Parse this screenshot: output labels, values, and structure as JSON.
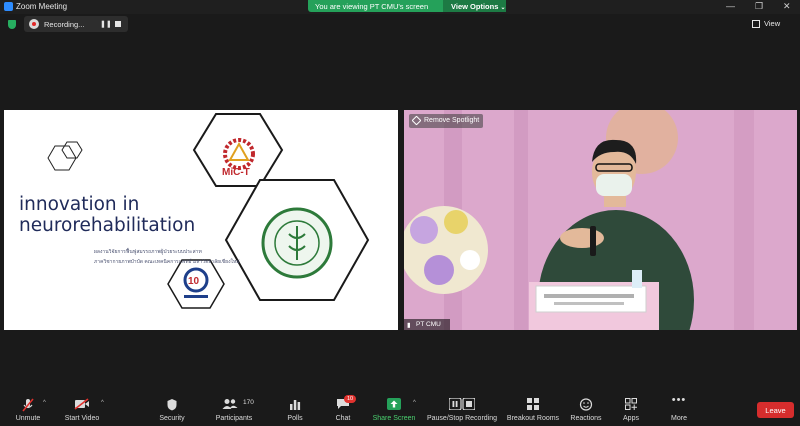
{
  "window": {
    "title": "Zoom Meeting"
  },
  "banner": {
    "message": "You are viewing PT CMU's screen",
    "view_options": "View Options"
  },
  "recording": {
    "label": "Recording..."
  },
  "view_button": {
    "label": "View"
  },
  "slide": {
    "title_line1": "innovation in",
    "title_line2": "neurorehabilitation",
    "subtitle_line1": "ผลงานวิจัยการฟื้นฟูสมรรถภาพผู้ป่วยระบบประสาท",
    "subtitle_line2": "ภาควิชากายภาพบำบัด คณะเทคนิคการแพทย์ มหาวิทยาลัยเชียงใหม่",
    "logo_mic_t": "MiC-T"
  },
  "camera": {
    "spotlight_label": "Remove Spotlight",
    "participant_name": "PT CMU"
  },
  "toolbar": {
    "unmute": "Unmute",
    "start_video": "Start Video",
    "security": "Security",
    "participants": "Participants",
    "participants_count": "170",
    "polls": "Polls",
    "chat": "Chat",
    "chat_badge": "10",
    "share_screen": "Share Screen",
    "pause_recording": "Pause/Stop Recording",
    "breakout_rooms": "Breakout Rooms",
    "reactions": "Reactions",
    "apps": "Apps",
    "more": "More",
    "leave": "Leave"
  },
  "colors": {
    "share_green": "#25a15a",
    "leave_red": "#d62d2d",
    "slide_navy": "#202b5a"
  }
}
